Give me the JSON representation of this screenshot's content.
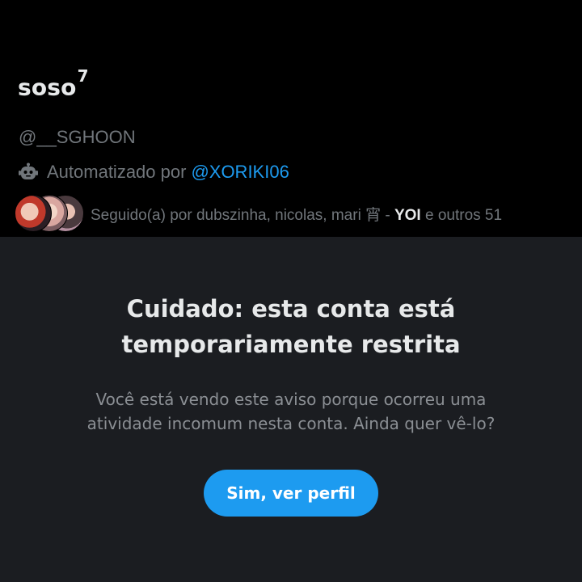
{
  "profile": {
    "name": "soso",
    "name_superscript": "7",
    "handle": "@__SGHOON",
    "automated_label": "Automatizado por",
    "automated_by": "@XORIKI06",
    "followed_prefix": "Seguido(a) por dubszinha, nicolas, mari 宵 - ",
    "followed_bold": "YOI",
    "followed_suffix": " e outros 51"
  },
  "warning": {
    "title_line1": "Cuidado: esta conta está",
    "title_line2": "temporariamente restrita",
    "body_line1": "Você está vendo este aviso porque ocorreu uma",
    "body_line2": "atividade incomum nesta conta. Ainda quer vê-lo?",
    "button_label": "Sim, ver perfil"
  },
  "colors": {
    "background": "#000000",
    "panel": "#1b1d21",
    "accent": "#1d9bf0",
    "muted_text": "#71767b",
    "primary_text": "#e7e9ea"
  },
  "icons": {
    "automated": "bot-icon"
  }
}
